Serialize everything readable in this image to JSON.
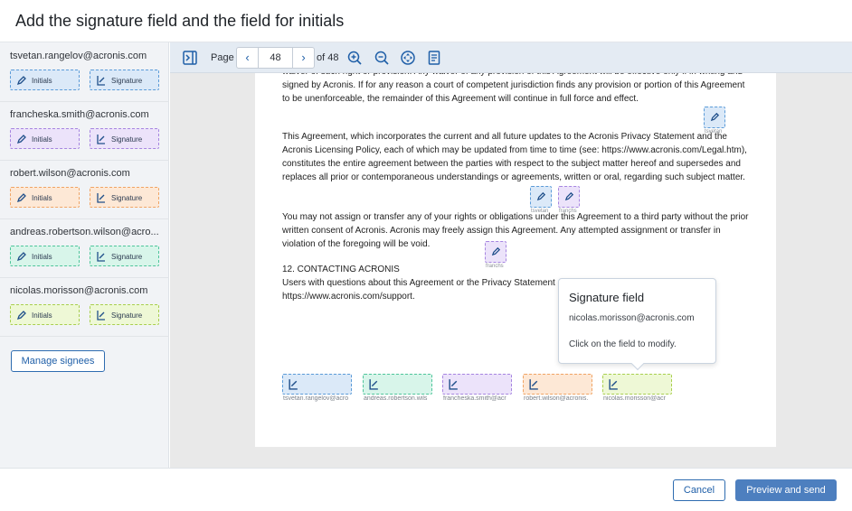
{
  "title": "Add the signature field and the field for initials",
  "colors": {
    "blue": {
      "bg": "#dbe9f8",
      "border": "#5b9bd8"
    },
    "purple": {
      "bg": "#ece3fa",
      "border": "#a685e0"
    },
    "orange": {
      "bg": "#fde8d6",
      "border": "#f0a464"
    },
    "green": {
      "bg": "#d8f5ea",
      "border": "#4fc59b"
    },
    "yellow": {
      "bg": "#eef8d6",
      "border": "#a9cf4f"
    },
    "accent": "#4d7fbf"
  },
  "sidebar": {
    "signees": [
      {
        "email": "tsvetan.rangelov@acronis.com",
        "initials_label": "Initials",
        "signature_label": "Signature"
      },
      {
        "email": "francheska.smith@acronis.com",
        "initials_label": "Initials",
        "signature_label": "Signature"
      },
      {
        "email": "robert.wilson@acronis.com",
        "initials_label": "Initials",
        "signature_label": "Signature"
      },
      {
        "email": "andreas.robertson.wilson@acro...",
        "initials_label": "Initials",
        "signature_label": "Signature"
      },
      {
        "email": "nicolas.morisson@acronis.com",
        "initials_label": "Initials",
        "signature_label": "Signature"
      }
    ],
    "manage_label": "Manage signees"
  },
  "toolbar": {
    "page_label": "Page",
    "page_number": "48",
    "prev": "‹",
    "next": "›",
    "of_label": "of 48",
    "icons": [
      "sidebar-toggle-icon",
      "zoom-in-icon",
      "zoom-out-icon",
      "fit-page-icon",
      "document-icon"
    ]
  },
  "document": {
    "p1": "waiver of such right or provision. Any waiver of any provision of this Agreement will be effective only if in writing and signed by Acronis. If for any reason a court of competent jurisdiction finds any provision or portion of this Agreement to be unenforceable, the remainder of this Agreement will continue in full force and effect.",
    "p2": "This Agreement, which incorporates the current and all future updates to the Acronis Privacy Statement and the Acronis Licensing Policy, each of which may be updated from time to time (see: https://www.acronis.com/Legal.htm), constitutes the entire agreement between the parties with respect to the subject matter hereof and supersedes and replaces all prior or contemporaneous understandings or agreements, written or oral, regarding such subject matter.",
    "p3": "You may not assign or transfer any of your rights or obligations under this Agreement to a third party without the prior written consent of Acronis. Acronis may freely assign this Agreement. Any attempted assignment or transfer in violation of the foregoing will be void.",
    "p4_heading": "12. CONTACTING ACRONIS",
    "p4_line1": " Users with questions about this Agreement or the Privacy Statement",
    "p4_line2": "https://www.acronis.com/support.",
    "initial_captions": [
      "tsvetan",
      "tsvetan",
      "franchs",
      "franchs"
    ],
    "signature_captions": [
      "tsvetan.rangelov@acro",
      "andreas.robertson.wils",
      "francheska.smith@acr",
      "robert.wilson@acronis.",
      "nicolas.morisson@acr"
    ]
  },
  "tooltip": {
    "title": "Signature field",
    "email": "nicolas.morisson@acronis.com",
    "hint": "Click on the field to modify."
  },
  "footer": {
    "cancel_label": "Cancel",
    "send_label": "Preview and send"
  }
}
